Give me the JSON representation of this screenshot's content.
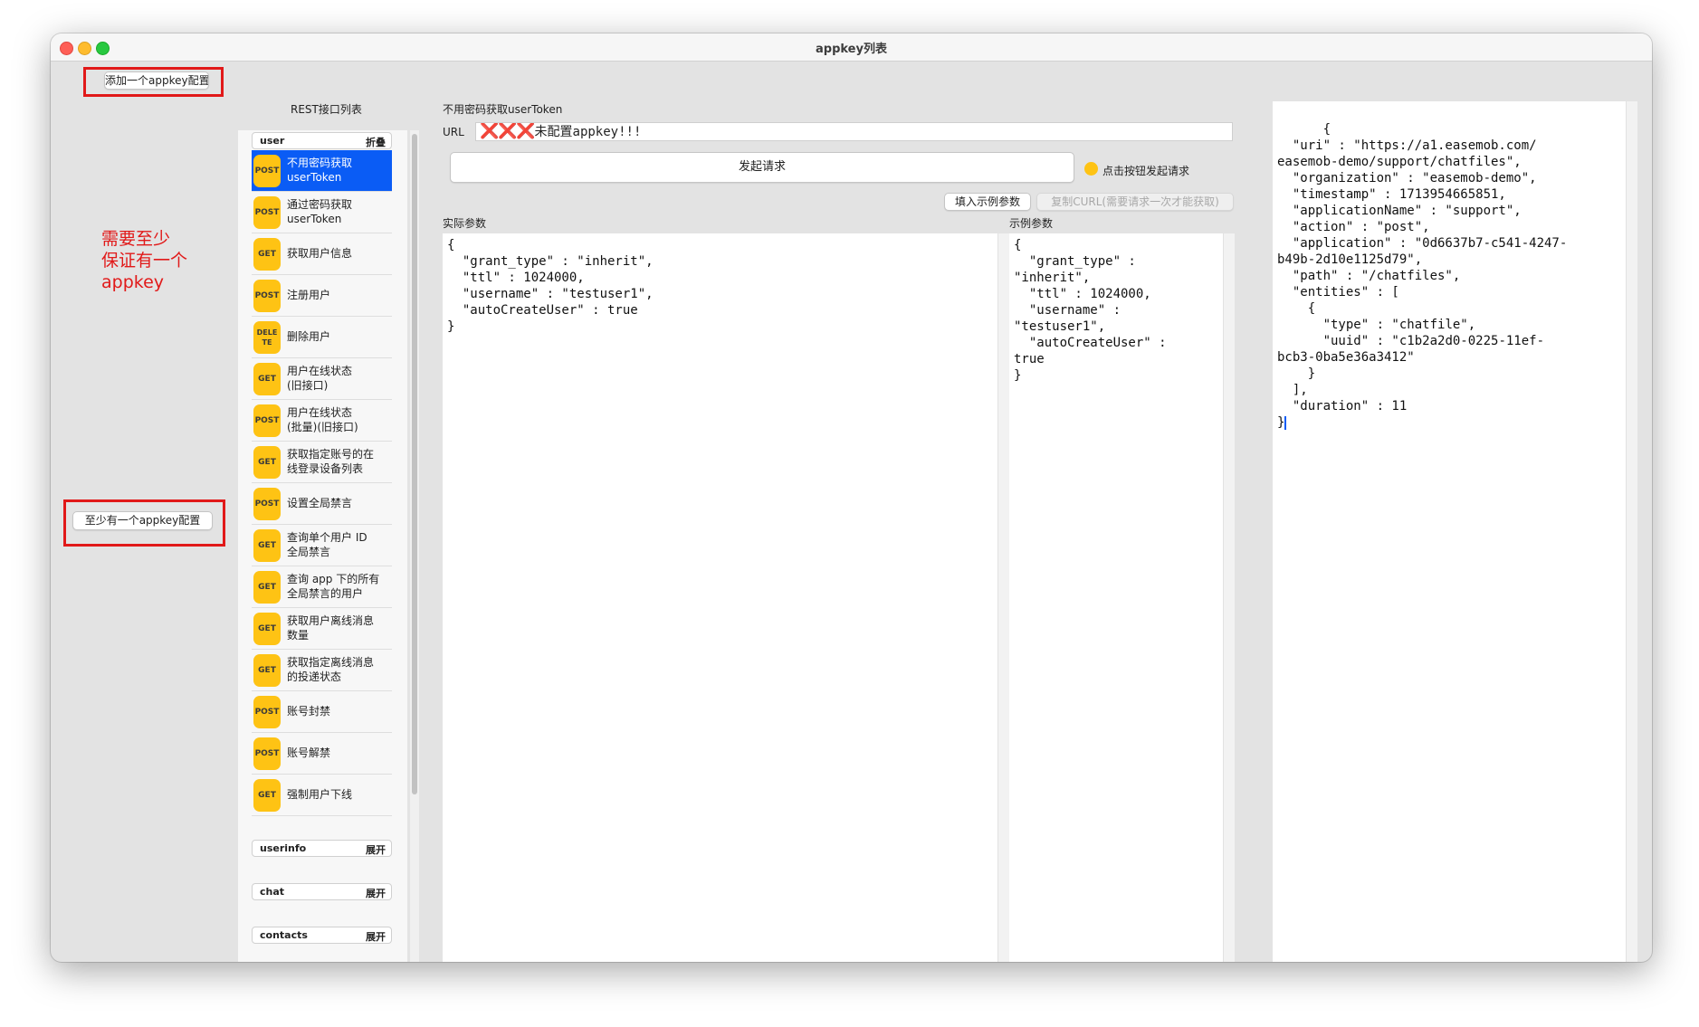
{
  "window": {
    "title": "appkey列表"
  },
  "left_panel": {
    "add_button": "添加一个appkey配置",
    "annotation_text": "需要至少\n保证有一个\nappkey",
    "min_button": "至少有一个appkey配置"
  },
  "rest_list": {
    "title": "REST接口列表",
    "groups": [
      {
        "name": "user",
        "toggle": "折叠"
      },
      {
        "name": "userinfo",
        "toggle": "展开"
      },
      {
        "name": "chat",
        "toggle": "展开"
      },
      {
        "name": "contacts",
        "toggle": "展开"
      }
    ],
    "items": [
      {
        "method": "POST",
        "label": "不用密码获取\nuserToken",
        "selected": true
      },
      {
        "method": "POST",
        "label": "通过密码获取\nuserToken"
      },
      {
        "method": "GET",
        "label": "获取用户信息"
      },
      {
        "method": "POST",
        "label": "注册用户"
      },
      {
        "method": "DELE\nTE",
        "label": "删除用户"
      },
      {
        "method": "GET",
        "label": "用户在线状态\n(旧接口)"
      },
      {
        "method": "POST",
        "label": "用户在线状态\n(批量)(旧接口)"
      },
      {
        "method": "GET",
        "label": "获取指定账号的在\n线登录设备列表"
      },
      {
        "method": "POST",
        "label": "设置全局禁言"
      },
      {
        "method": "GET",
        "label": "查询单个用户 ID\n全局禁言"
      },
      {
        "method": "GET",
        "label": "查询 app 下的所有\n全局禁言的用户"
      },
      {
        "method": "GET",
        "label": "获取用户离线消息\n数量"
      },
      {
        "method": "GET",
        "label": "获取指定离线消息\n的投递状态"
      },
      {
        "method": "POST",
        "label": "账号封禁"
      },
      {
        "method": "POST",
        "label": "账号解禁"
      },
      {
        "method": "GET",
        "label": "强制用户下线"
      }
    ]
  },
  "request": {
    "title": "不用密码获取userToken",
    "url_label": "URL",
    "url_mark": "❌❌❌",
    "url_value": "未配置appkey!!!",
    "send_button": "发起请求",
    "status_text": "点击按钮发起请求",
    "fill_example_button": "填入示例参数",
    "copy_curl_button": "复制CURL(需要请求一次才能获取)",
    "actual_params_label": "实际参数",
    "actual_params": "{\n  \"grant_type\" : \"inherit\",\n  \"ttl\" : 1024000,\n  \"username\" : \"testuser1\",\n  \"autoCreateUser\" : true\n}",
    "example_params_label": "示例参数",
    "example_params": "{\n  \"grant_type\" :\n\"inherit\",\n  \"ttl\" : 1024000,\n  \"username\" :\n\"testuser1\",\n  \"autoCreateUser\" :\ntrue\n}"
  },
  "response": {
    "body": "{\n  \"uri\" : \"https://a1.easemob.com/\neasemob-demo/support/chatfiles\",\n  \"organization\" : \"easemob-demo\",\n  \"timestamp\" : 1713954665851,\n  \"applicationName\" : \"support\",\n  \"action\" : \"post\",\n  \"application\" : \"0d6637b7-c541-4247-\nb49b-2d10e1125d79\",\n  \"path\" : \"/chatfiles\",\n  \"entities\" : [\n    {\n      \"type\" : \"chatfile\",\n      \"uuid\" : \"c1b2a2d0-0225-11ef-\nbcb3-0ba5e36a3412\"\n    }\n  ],\n  \"duration\" : 11\n",
    "body_end": "}"
  },
  "colors": {
    "accent": "#0a5cf5",
    "badge": "#fec314",
    "annotation": "#e11919"
  }
}
